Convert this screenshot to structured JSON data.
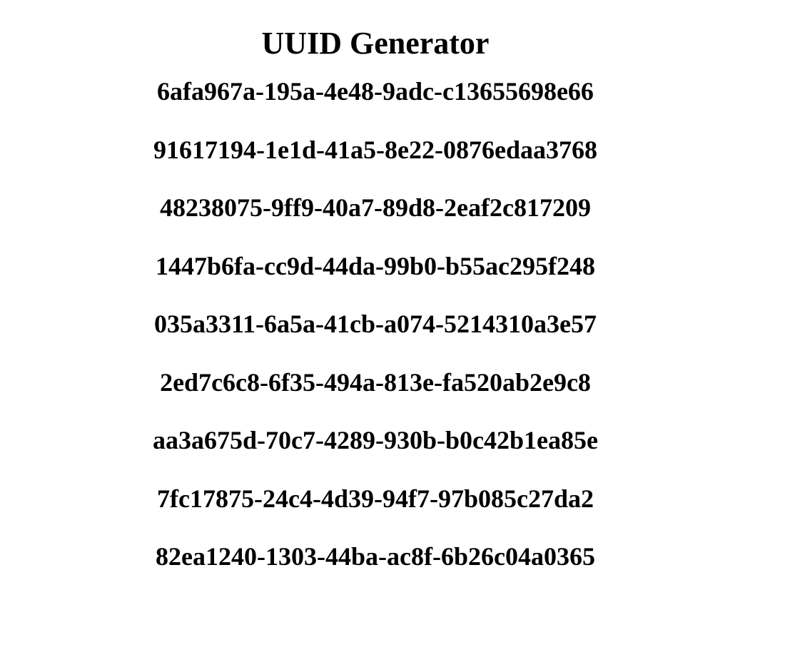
{
  "page": {
    "title": "UUID Generator"
  },
  "uuids": [
    "6afa967a-195a-4e48-9adc-c13655698e66",
    "91617194-1e1d-41a5-8e22-0876edaa3768",
    "48238075-9ff9-40a7-89d8-2eaf2c817209",
    "1447b6fa-cc9d-44da-99b0-b55ac295f248",
    "035a3311-6a5a-41cb-a074-5214310a3e57",
    "2ed7c6c8-6f35-494a-813e-fa520ab2e9c8",
    "aa3a675d-70c7-4289-930b-b0c42b1ea85e",
    "7fc17875-24c4-4d39-94f7-97b085c27da2",
    "82ea1240-1303-44ba-ac8f-6b26c04a0365"
  ],
  "colors": {
    "background": "#ffffff",
    "text": "#000000"
  }
}
